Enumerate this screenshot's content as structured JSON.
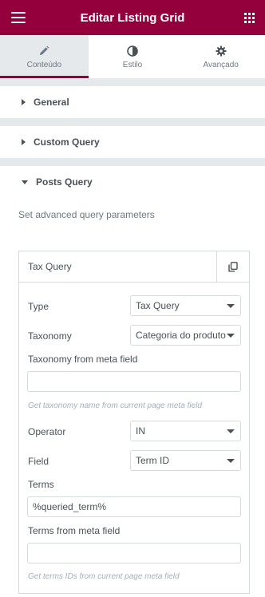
{
  "header": {
    "title": "Editar Listing Grid",
    "menu_icon": "hamburger-icon",
    "apps_icon": "grid-icon"
  },
  "tabs": [
    {
      "label": "Conteúdo",
      "icon": "pencil-icon",
      "active": true
    },
    {
      "label": "Estilo",
      "icon": "contrast-icon",
      "active": false
    },
    {
      "label": "Avançado",
      "icon": "gear-icon",
      "active": false
    }
  ],
  "sections": {
    "general": {
      "label": "General"
    },
    "custom_query": {
      "label": "Custom Query"
    },
    "posts_query": {
      "label": "Posts Query",
      "description": "Set advanced query parameters"
    }
  },
  "repeater": {
    "title": "Tax Query",
    "fields": {
      "type": {
        "label": "Type",
        "value": "Tax Query"
      },
      "taxonomy": {
        "label": "Taxonomy",
        "value": "Categoria do produto"
      },
      "taxonomy_meta": {
        "label": "Taxonomy from meta field",
        "value": "",
        "hint": "Get taxonomy name from current page meta field"
      },
      "operator": {
        "label": "Operator",
        "value": "IN"
      },
      "field": {
        "label": "Field",
        "value": "Term ID"
      },
      "terms": {
        "label": "Terms",
        "value": "%queried_term%"
      },
      "terms_meta": {
        "label": "Terms from meta field",
        "value": "",
        "hint": "Get terms IDs from current page meta field"
      }
    }
  },
  "colors": {
    "brand": "#93003c",
    "panel_bg": "#e6e9ec",
    "text": "#495157",
    "muted": "#a4afb7"
  }
}
